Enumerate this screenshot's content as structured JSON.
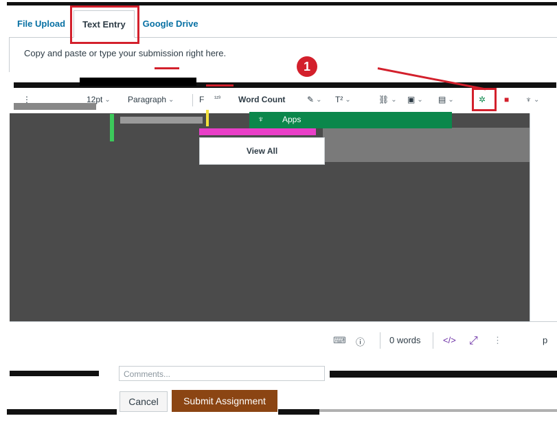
{
  "tabs": [
    {
      "label": "File Upload",
      "active": false
    },
    {
      "label": "Text Entry",
      "active": true
    },
    {
      "label": "Google Drive",
      "active": false
    }
  ],
  "instructions": "Copy and paste or type your submission right here.",
  "step_number": "1",
  "toolbar": {
    "font_size": "12pt",
    "paragraph": "Paragraph",
    "word_count": "Word Count",
    "superscript": "T²"
  },
  "apps_menu": {
    "label": "Apps",
    "view_all": "View All"
  },
  "statusbar": {
    "words": "0 words",
    "html_toggle": "</>",
    "block": "p"
  },
  "comments_placeholder": "Comments...",
  "buttons": {
    "cancel": "Cancel",
    "submit": "Submit Assignment"
  },
  "colors": {
    "highlight_red": "#d3202c",
    "link_blue": "#0770a3",
    "apps_green": "#0b874b",
    "submit_brown": "#8b4513"
  }
}
